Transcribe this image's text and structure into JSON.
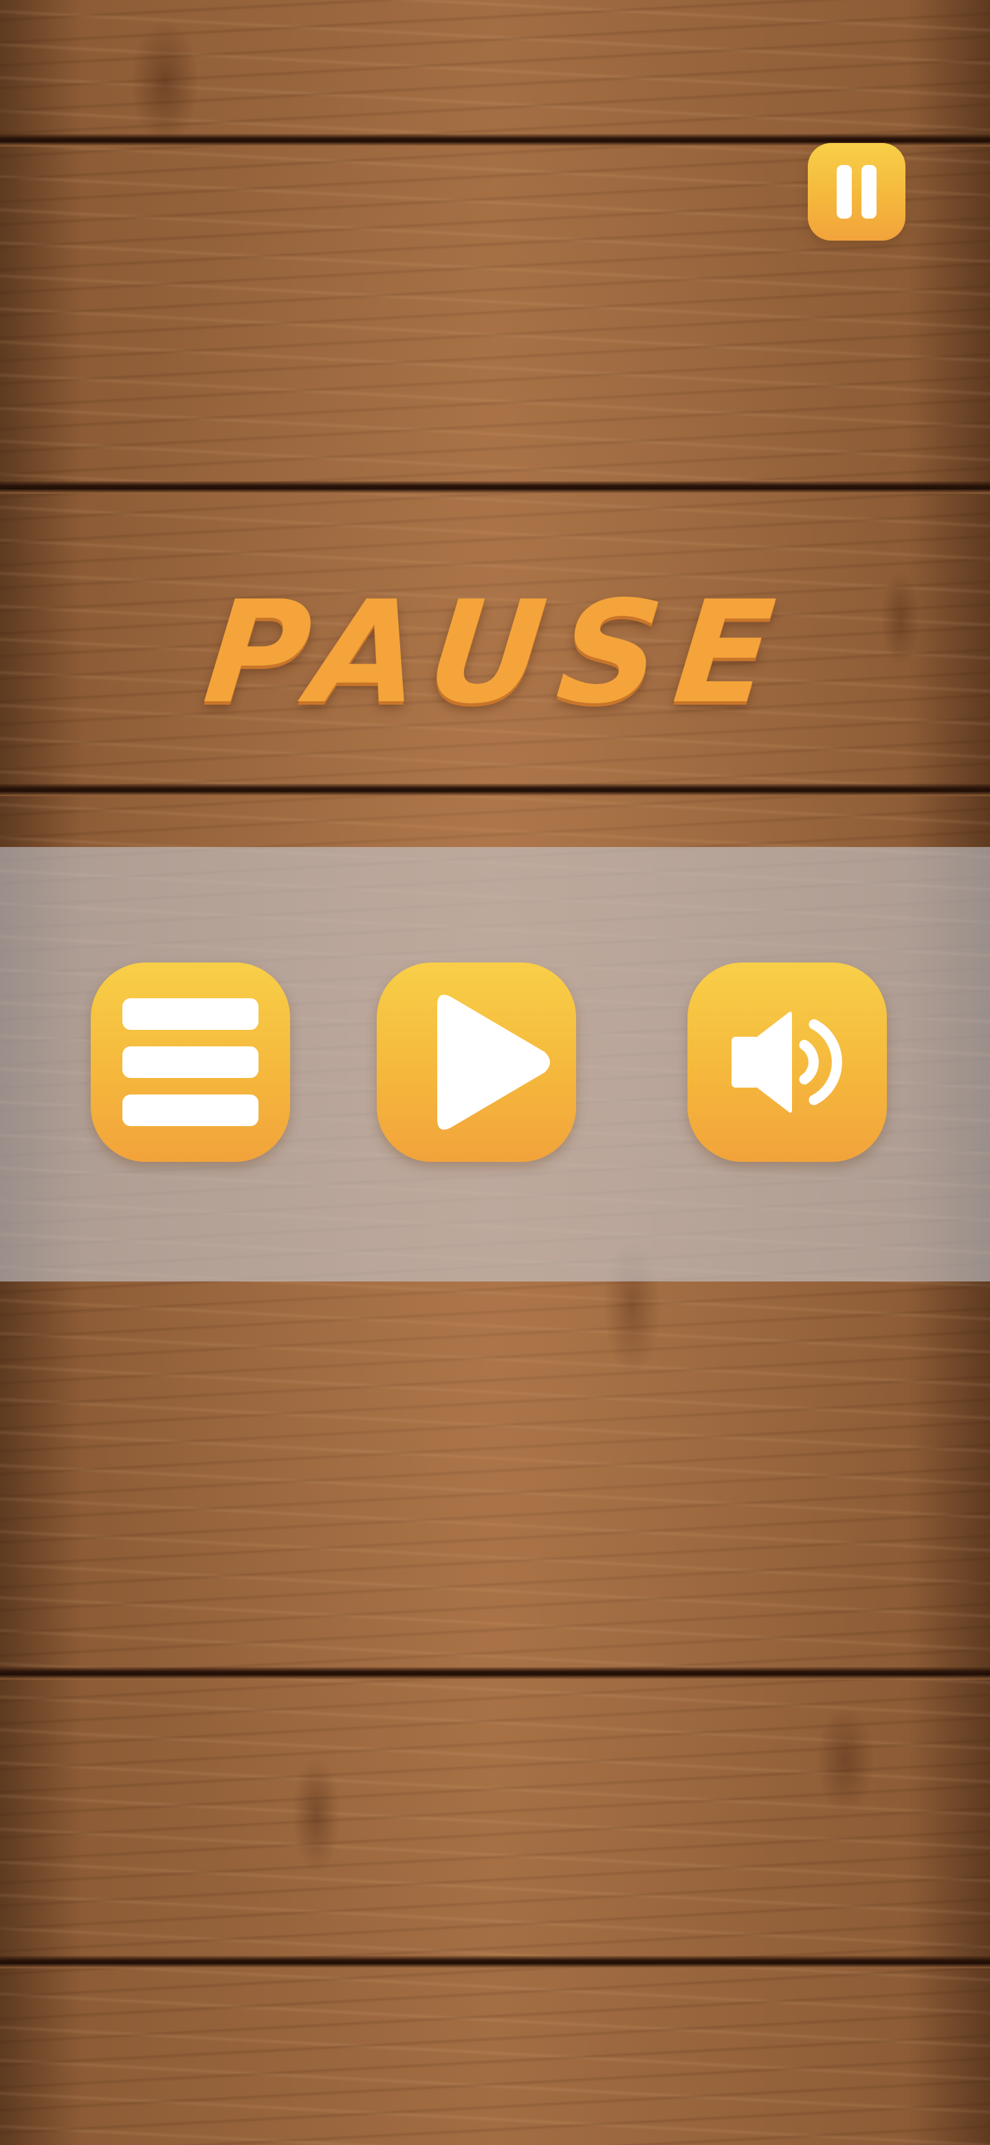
{
  "screen": {
    "title": "PAUSE"
  },
  "controls": {
    "pause_button": {
      "icon": "pause-icon"
    },
    "menu_button": {
      "icon": "menu-icon"
    },
    "play_button": {
      "icon": "play-icon"
    },
    "sound_button": {
      "icon": "speaker-icon"
    }
  },
  "colors": {
    "button_top": "#f8cf48",
    "button_bottom": "#f2a33b",
    "title": "#f4a43a",
    "icon": "#ffffff",
    "wood": "#8a5a34",
    "overlay": "rgba(200,205,215,0.58)"
  }
}
